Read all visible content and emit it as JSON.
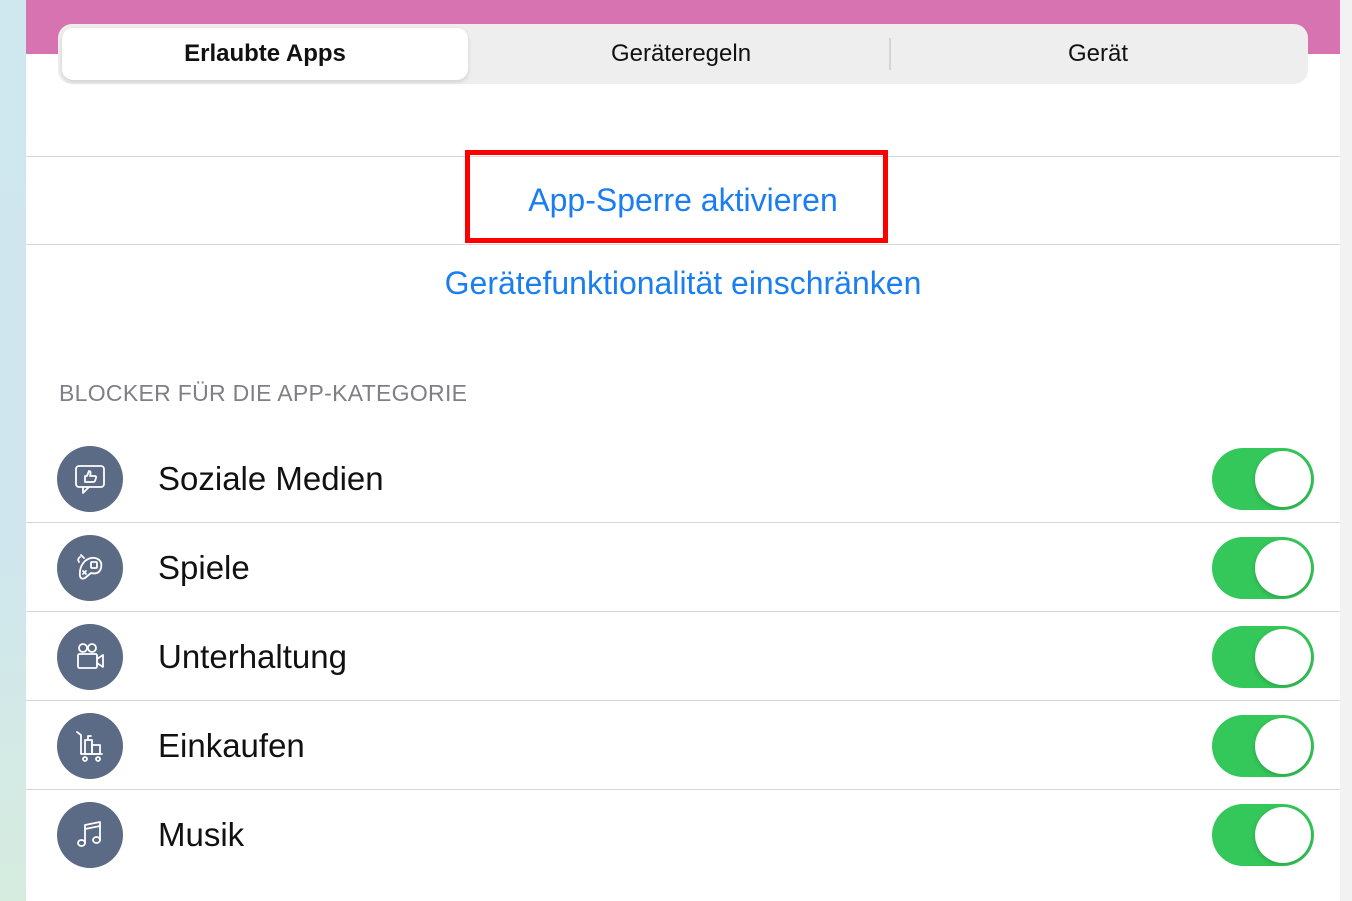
{
  "tabs": [
    {
      "label": "Erlaubte Apps",
      "active": true
    },
    {
      "label": "Geräteregeln",
      "active": false
    },
    {
      "label": "Gerät",
      "active": false
    }
  ],
  "actions": {
    "app_lock": "App-Sperre aktivieren",
    "restrict_device": "Gerätefunktionalität einschränken"
  },
  "section": {
    "header": "BLOCKER FÜR DIE APP-KATEGORIE"
  },
  "categories": [
    {
      "label": "Soziale Medien",
      "icon": "social-media-icon",
      "enabled": true
    },
    {
      "label": "Spiele",
      "icon": "games-icon",
      "enabled": true
    },
    {
      "label": "Unterhaltung",
      "icon": "entertainment-icon",
      "enabled": true
    },
    {
      "label": "Einkaufen",
      "icon": "shopping-icon",
      "enabled": true
    },
    {
      "label": "Musik",
      "icon": "music-icon",
      "enabled": true
    }
  ],
  "colors": {
    "header_accent": "#d873b1",
    "link": "#1a7ef0",
    "toggle_on": "#34c759",
    "icon_bg": "#5b6a85",
    "highlight": "#ff0000"
  }
}
